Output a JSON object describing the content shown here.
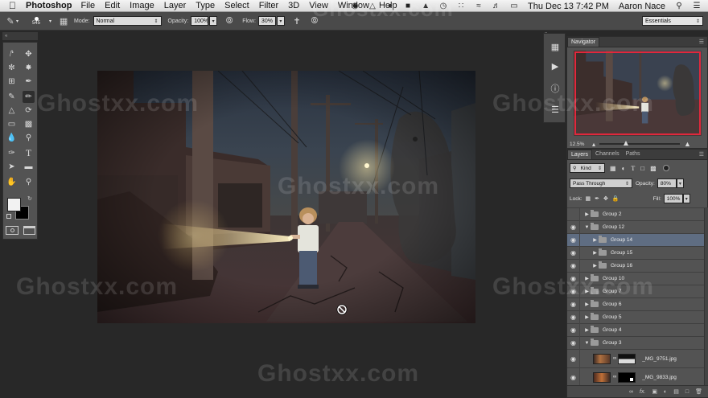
{
  "menubar": {
    "app": "Photoshop",
    "items": [
      "File",
      "Edit",
      "Image",
      "Layer",
      "Type",
      "Select",
      "Filter",
      "3D",
      "View",
      "Window",
      "Help"
    ],
    "datetime": "Thu Dec 13  7:42 PM",
    "user": "Aaron Nace"
  },
  "options": {
    "brush_size": "545",
    "mode_label": "Mode:",
    "mode_value": "Normal",
    "opacity_label": "Opacity:",
    "opacity_value": "100%",
    "flow_label": "Flow:",
    "flow_value": "30%",
    "workspace": "Essentials"
  },
  "navigator": {
    "tab": "Navigator",
    "zoom": "12.5%"
  },
  "layers": {
    "tabs": [
      "Layers",
      "Channels",
      "Paths"
    ],
    "filter_kind": "Kind",
    "blend_mode": "Pass Through",
    "opacity_label": "Opacity:",
    "opacity_value": "80%",
    "lock_label": "Lock:",
    "fill_label": "Fill:",
    "fill_value": "100%",
    "list": [
      {
        "name": "Group 2",
        "visible": false,
        "expanded": false,
        "indent": 0,
        "selected": false
      },
      {
        "name": "Group 12",
        "visible": true,
        "expanded": true,
        "indent": 0,
        "selected": false
      },
      {
        "name": "Group 14",
        "visible": true,
        "expanded": false,
        "indent": 1,
        "selected": true
      },
      {
        "name": "Group 15",
        "visible": true,
        "expanded": false,
        "indent": 1,
        "selected": false
      },
      {
        "name": "Group 16",
        "visible": true,
        "expanded": false,
        "indent": 1,
        "selected": false
      },
      {
        "name": "Group 10",
        "visible": true,
        "expanded": false,
        "indent": 0,
        "selected": false
      },
      {
        "name": "Group 7",
        "visible": true,
        "expanded": false,
        "indent": 0,
        "selected": false
      },
      {
        "name": "Group 6",
        "visible": true,
        "expanded": false,
        "indent": 0,
        "selected": false
      },
      {
        "name": "Group 5",
        "visible": true,
        "expanded": false,
        "indent": 0,
        "selected": false
      },
      {
        "name": "Group 4",
        "visible": true,
        "expanded": false,
        "indent": 0,
        "selected": false
      },
      {
        "name": "Group 3",
        "visible": true,
        "expanded": true,
        "indent": 0,
        "selected": false
      }
    ],
    "image_layers": [
      "_MG_9751.jpg",
      "_MG_9833.jpg"
    ]
  },
  "watermark": "Ghostxx.com",
  "colors": {
    "accent_selected": "#5f6d82",
    "navigator_frame": "#e0283c",
    "panel_bg": "#535353",
    "app_bg": "#282828"
  }
}
